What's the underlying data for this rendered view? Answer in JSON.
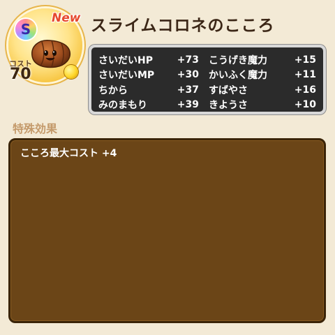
{
  "header": {
    "rank": "S",
    "new_badge": "New",
    "title": "スライムコロネのこころ",
    "cost_label": "コスト",
    "cost_value": "70"
  },
  "stats": {
    "rows": [
      {
        "left_label": "さいだいHP",
        "left_value": "+73",
        "right_label": "こうげき魔力",
        "right_value": "+15"
      },
      {
        "left_label": "さいだいMP",
        "left_value": "+30",
        "right_label": "かいふく魔力",
        "right_value": "+11"
      },
      {
        "left_label": "ちから",
        "left_value": "+37",
        "right_label": "すばやさ",
        "right_value": "+16"
      },
      {
        "left_label": "みのまもり",
        "left_value": "+39",
        "right_label": "きようさ",
        "right_value": "+10"
      }
    ]
  },
  "special": {
    "title": "特殊効果",
    "effects": [
      "こころ最大コスト +4"
    ]
  },
  "colors": {
    "background": "#f3ead6",
    "title_text": "#3b2616",
    "stats_panel": "#2b2b2b",
    "effect_panel": "#6b4517",
    "section_title": "#c49a6b",
    "new_badge": "#e64a2e"
  }
}
